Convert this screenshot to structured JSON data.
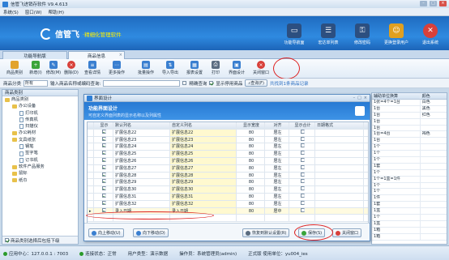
{
  "app": {
    "title": "信管飞进销存软件 V9.4.613"
  },
  "menu": [
    "系统(S)",
    "窗口(W)",
    "帮助(H)"
  ],
  "banner": {
    "logo_name": "信管飞",
    "logo_tagline": "·精细化管理软件",
    "buttons": [
      {
        "label": "功能导航面",
        "icon": "monitor-icon",
        "color": "#2c4f80"
      },
      {
        "label": "宏达单列表",
        "icon": "list-icon",
        "color": "#2c4f80"
      },
      {
        "label": "修改密码",
        "icon": "key-icon",
        "color": "#2c4f80"
      },
      {
        "label": "更换登录用户",
        "icon": "users-icon",
        "color": "#e0a020"
      },
      {
        "label": "退出系统",
        "icon": "exit-icon",
        "color": "#d8403a"
      }
    ]
  },
  "tabs": [
    {
      "label": "功能导航版"
    },
    {
      "label": "商品信息"
    }
  ],
  "toolbar": [
    {
      "label": "商品类别",
      "icon": "folder-icon",
      "color": "#e2a32b"
    },
    {
      "label": "新增(I)",
      "icon": "add-icon",
      "color": "#3aa43a"
    },
    {
      "label": "修改(M)",
      "icon": "edit-icon",
      "color": "#3a7fd0"
    },
    {
      "label": "删除(D)",
      "icon": "delete-icon",
      "color": "#d8403a"
    },
    {
      "label": "查看详情",
      "icon": "details-icon",
      "color": "#3a7fd0"
    },
    {
      "label": "更多操作",
      "icon": "more-icon",
      "color": "#3a7fd0"
    },
    {
      "label": "批量操作",
      "icon": "batch-icon",
      "color": "#3a7fd0"
    },
    {
      "label": "导入导出",
      "icon": "import-export-icon",
      "color": "#3a7fd0"
    },
    {
      "label": "报表设置",
      "icon": "report-icon",
      "color": "#3a7fd0"
    },
    {
      "label": "打印",
      "icon": "print-icon",
      "color": "#5a6c80"
    },
    {
      "label": "界面设计",
      "icon": "layout-design-icon",
      "color": "#3a7fd0"
    },
    {
      "label": "关闭窗口",
      "icon": "close-window-icon",
      "color": "#d8403a"
    }
  ],
  "filter": {
    "category_label": "商品分类",
    "category_value": "所有",
    "keyword_label": "输入商品名称或编码查询:",
    "precise_label": "精确查询",
    "show_disabled_label": "显示停用商品",
    "query_button": "查询(F)",
    "record_hint": "共找到1条商品记录"
  },
  "left": {
    "header": "商品类别",
    "tree": [
      {
        "label": "商品类别",
        "type": "folder",
        "level": 0
      },
      {
        "label": "办公设备",
        "type": "folder",
        "level": 1
      },
      {
        "label": "打印机",
        "type": "doc",
        "level": 2
      },
      {
        "label": "传真机",
        "type": "doc",
        "level": 2
      },
      {
        "label": "扫描仪",
        "type": "doc",
        "level": 2
      },
      {
        "label": "办公耗材",
        "type": "folder",
        "level": 1
      },
      {
        "label": "文具纸张",
        "type": "folder",
        "level": 1
      },
      {
        "label": "钢笔",
        "type": "doc",
        "level": 2
      },
      {
        "label": "签字笔",
        "type": "doc",
        "level": 2
      },
      {
        "label": "订书机",
        "type": "doc",
        "level": 2
      },
      {
        "label": "软件产品服务",
        "type": "folder",
        "level": 1
      },
      {
        "label": "鼠标",
        "type": "folder",
        "level": 1
      },
      {
        "label": "纸巾",
        "type": "folder",
        "level": 1
      }
    ],
    "footer": "商品类别选择后包括下级"
  },
  "right": {
    "header": [
      "辅助单位换算",
      "颜色"
    ],
    "rows": [
      [
        "1张=4个=1台",
        "白色"
      ],
      [
        "1台",
        "黑色"
      ],
      [
        "1台",
        "红色"
      ],
      [
        "1台",
        ""
      ],
      [
        "1台",
        ""
      ],
      [
        "1台=4台",
        "褐色"
      ],
      [
        "1台",
        ""
      ],
      [
        "1个",
        ""
      ],
      [
        "1个",
        ""
      ],
      [
        "1个",
        ""
      ],
      [
        "1套",
        ""
      ],
      [
        "1个",
        ""
      ],
      [
        "1个=1盒=1件",
        ""
      ],
      [
        "1个",
        ""
      ],
      [
        "1个",
        ""
      ],
      [
        "1件",
        ""
      ],
      [
        "1套",
        ""
      ],
      [
        "1盒",
        ""
      ],
      [
        "1个",
        ""
      ],
      [
        "1盒",
        ""
      ],
      [
        "1箱",
        ""
      ],
      [
        "1箱",
        ""
      ]
    ]
  },
  "dialog": {
    "title": "界面设计",
    "head_title": "功能界面设计",
    "head_desc": "可自定义界面列表的显示名称以及列属性",
    "columns": [
      "显示",
      "默认列名",
      "自定义列名",
      "显示宽度",
      "对齐",
      "显示合计",
      "日期格式"
    ],
    "rows": [
      {
        "check": true,
        "name": "扩展信息22",
        "custom": "扩展信息22",
        "width": "80",
        "align": "居左"
      },
      {
        "check": true,
        "name": "扩展信息23",
        "custom": "扩展信息23",
        "width": "80",
        "align": "居左"
      },
      {
        "check": true,
        "name": "扩展信息24",
        "custom": "扩展信息24",
        "width": "80",
        "align": "居左"
      },
      {
        "check": true,
        "name": "扩展信息25",
        "custom": "扩展信息25",
        "width": "80",
        "align": "居左"
      },
      {
        "check": true,
        "name": "扩展信息26",
        "custom": "扩展信息26",
        "width": "80",
        "align": "居左"
      },
      {
        "check": true,
        "name": "扩展信息27",
        "custom": "扩展信息27",
        "width": "80",
        "align": "居左"
      },
      {
        "check": true,
        "name": "扩展信息28",
        "custom": "扩展信息28",
        "width": "80",
        "align": "居左"
      },
      {
        "check": true,
        "name": "扩展信息29",
        "custom": "扩展信息29",
        "width": "80",
        "align": "居左"
      },
      {
        "check": true,
        "name": "扩展信息30",
        "custom": "扩展信息30",
        "width": "80",
        "align": "居左"
      },
      {
        "check": true,
        "name": "扩展信息31",
        "custom": "扩展信息31",
        "width": "80",
        "align": "居左"
      },
      {
        "check": true,
        "name": "扩展信息32",
        "custom": "扩展信息32",
        "width": "80",
        "align": "居左"
      },
      {
        "check": true,
        "name": "录入日期",
        "custom": "录入日期",
        "width": "80",
        "align": "居中"
      },
      {
        "check": false,
        "name": "",
        "custom": "",
        "width": "",
        "align": ""
      }
    ],
    "footer": {
      "up": "向上移动(U)",
      "down": "向下移动(D)",
      "restore": "恢复到默认设置(R)",
      "save": "保存(S)",
      "close": "关闭窗口"
    }
  },
  "status": {
    "ip": "应用中心：127.0.0.1 : 7003",
    "conn": "连接状态：正常",
    "user_type": "用户类型：演示数据",
    "operator": "操作员：系统管理员(admin)",
    "version": "正式版 使用单位：yu004_ies"
  }
}
